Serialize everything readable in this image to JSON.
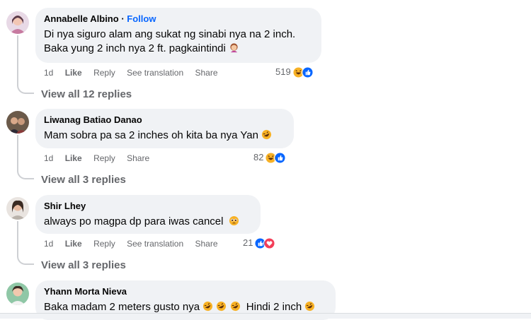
{
  "comments": [
    {
      "author": "Annabelle Albino",
      "follow": "Follow",
      "lines": [
        "Di nya siguro alam ang sukat ng sinabi nya na 2 inch.",
        "Baka yung 2 inch nya 2 ft. pagkaintindi"
      ],
      "time": "1d",
      "like": "Like",
      "reply": "Reply",
      "translate": "See translation",
      "share": "Share",
      "reaction_count": "519",
      "reactions": [
        "haha-icon",
        "like-icon"
      ],
      "view_replies": "View all 12 replies"
    },
    {
      "author": "Liwanag Batiao Danao",
      "lines": [
        "Mam sobra pa sa 2 inches oh kita ba nya Yan"
      ],
      "time": "1d",
      "like": "Like",
      "reply": "Reply",
      "share": "Share",
      "reaction_count": "82",
      "reactions": [
        "haha-icon",
        "like-icon"
      ],
      "view_replies": "View all 3 replies"
    },
    {
      "author": "Shir Lhey",
      "lines": [
        "always po magpa dp para iwas cancel"
      ],
      "time": "1d",
      "like": "Like",
      "reply": "Reply",
      "translate": "See translation",
      "share": "Share",
      "reaction_count": "21",
      "reactions": [
        "like-icon",
        "love-icon"
      ],
      "view_replies": "View all 3 replies"
    },
    {
      "author": "Yhann Morta Nieva",
      "lines": [
        "Baka madam 2 meters gusto nya",
        "Hindi 2 inch"
      ]
    }
  ],
  "colors": {
    "bubble": "#f0f2f5",
    "link_blue": "#0866ff",
    "meta_gray": "#65676b",
    "like_blue": "#0866ff",
    "haha_yellow": "#f7b125",
    "love_red": "#f33e58"
  }
}
